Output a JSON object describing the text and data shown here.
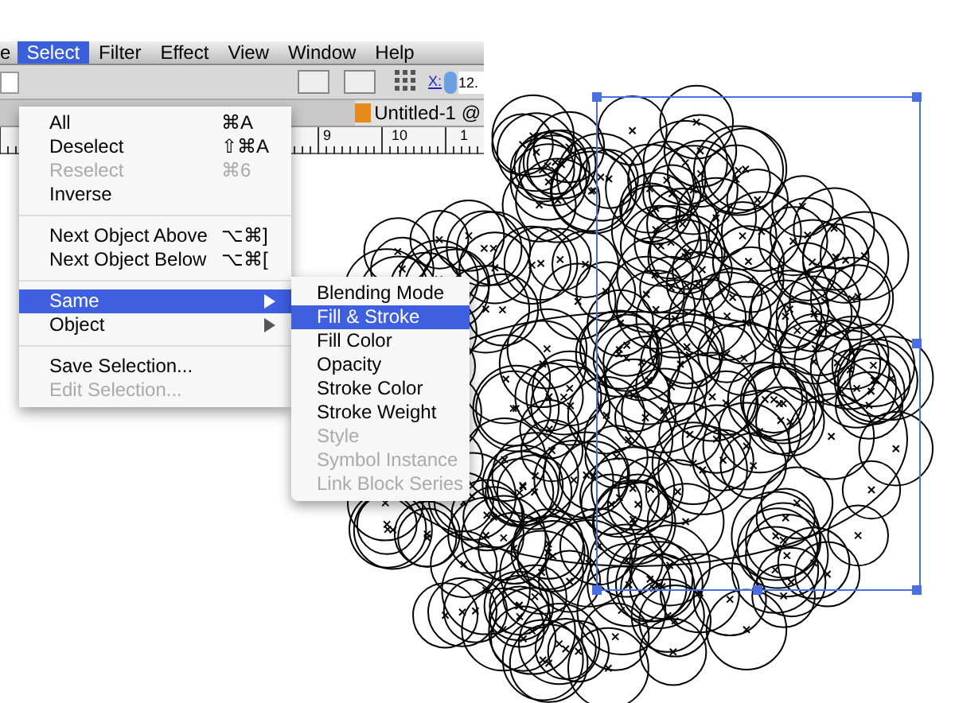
{
  "menubar": [
    {
      "label": "e",
      "selected": false
    },
    {
      "label": "Select",
      "selected": true
    },
    {
      "label": "Filter",
      "selected": false
    },
    {
      "label": "Effect",
      "selected": false
    },
    {
      "label": "View",
      "selected": false
    },
    {
      "label": "Window",
      "selected": false
    },
    {
      "label": "Help",
      "selected": false
    }
  ],
  "toolbar": {
    "x_label": "X:",
    "x_value": "12."
  },
  "document_tab": {
    "title": "Untitled-1 @"
  },
  "ruler": [
    "9",
    "10",
    "1"
  ],
  "select_menu": [
    {
      "kind": "item",
      "label": "All",
      "shortcut": "⌘A",
      "disabled": false,
      "selected": false,
      "submenu": false
    },
    {
      "kind": "item",
      "label": "Deselect",
      "shortcut": "⇧⌘A",
      "disabled": false,
      "selected": false,
      "submenu": false
    },
    {
      "kind": "item",
      "label": "Reselect",
      "shortcut": "⌘6",
      "disabled": true,
      "selected": false,
      "submenu": false
    },
    {
      "kind": "item",
      "label": "Inverse",
      "disabled": false,
      "selected": false,
      "submenu": false
    },
    {
      "kind": "separator"
    },
    {
      "kind": "item",
      "label": "Next Object Above",
      "shortcut": "⌥⌘]",
      "disabled": false,
      "selected": false,
      "submenu": false
    },
    {
      "kind": "item",
      "label": "Next Object Below",
      "shortcut": "⌥⌘[",
      "disabled": false,
      "selected": false,
      "submenu": false
    },
    {
      "kind": "separator"
    },
    {
      "kind": "item",
      "label": "Same",
      "disabled": false,
      "selected": true,
      "submenu": true
    },
    {
      "kind": "item",
      "label": "Object",
      "disabled": false,
      "selected": false,
      "submenu": true
    },
    {
      "kind": "separator"
    },
    {
      "kind": "item",
      "label": "Save Selection...",
      "disabled": false,
      "selected": false,
      "submenu": false
    },
    {
      "kind": "item",
      "label": "Edit Selection...",
      "disabled": true,
      "selected": false,
      "submenu": false
    }
  ],
  "same_submenu": [
    {
      "label": "Blending Mode",
      "disabled": false,
      "selected": false
    },
    {
      "label": "Fill & Stroke",
      "disabled": false,
      "selected": true
    },
    {
      "label": "Fill Color",
      "disabled": false,
      "selected": false
    },
    {
      "label": "Opacity",
      "disabled": false,
      "selected": false
    },
    {
      "label": "Stroke Color",
      "disabled": false,
      "selected": false
    },
    {
      "label": "Stroke Weight",
      "disabled": false,
      "selected": false
    },
    {
      "label": "Style",
      "disabled": true,
      "selected": false
    },
    {
      "label": "Symbol Instance",
      "disabled": true,
      "selected": false
    },
    {
      "label": "Link Block Series",
      "disabled": true,
      "selected": false
    }
  ]
}
